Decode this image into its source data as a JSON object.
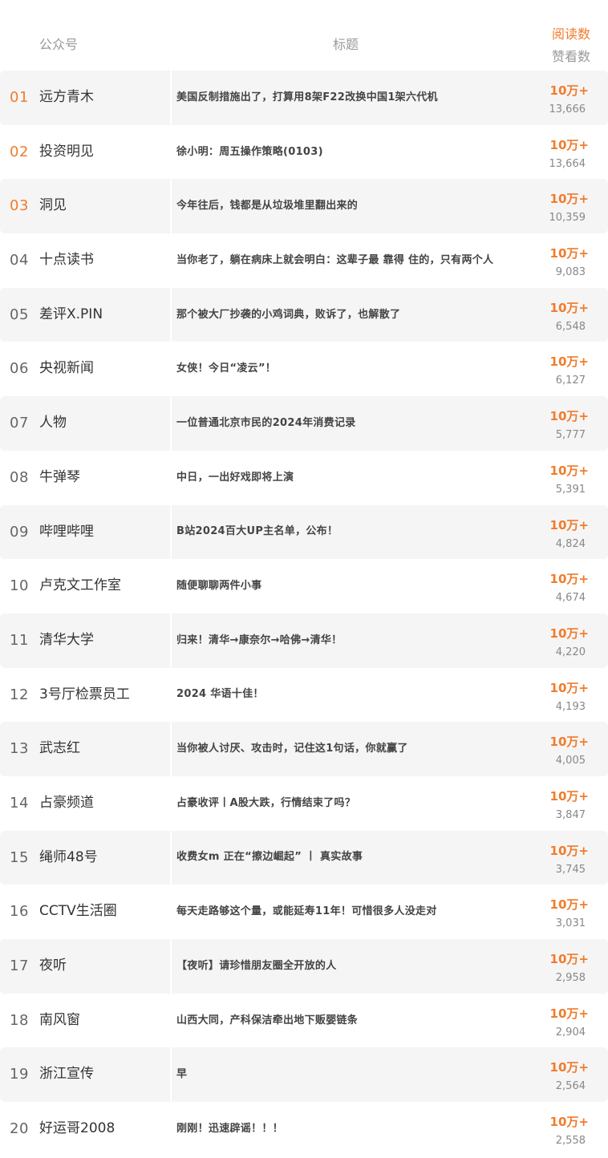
{
  "header": {
    "account_label": "公众号",
    "title_label": "标题",
    "reads_label": "阅读数",
    "likes_label": "赞看数"
  },
  "colors": {
    "accent": "#f07c2c",
    "row_shade": "#f5f5f5",
    "muted": "#9a9a9a"
  },
  "rows": [
    {
      "rank": "01",
      "account": "远方青木",
      "title": "美国反制措施出了，打算用8架F22改换中国1架六代机",
      "reads": "10万+",
      "likes": "13,666"
    },
    {
      "rank": "02",
      "account": "投资明见",
      "title": "徐小明：周五操作策略(0103)",
      "reads": "10万+",
      "likes": "13,664"
    },
    {
      "rank": "03",
      "account": "洞见",
      "title": "今年往后，钱都是从垃圾堆里翻出来的",
      "reads": "10万+",
      "likes": "10,359"
    },
    {
      "rank": "04",
      "account": "十点读书",
      "title": "当你老了，躺在病床上就会明白：这辈子最 靠得 住的，只有两个人",
      "reads": "10万+",
      "likes": "9,083"
    },
    {
      "rank": "05",
      "account": "差评X.PIN",
      "title": "那个被大厂抄袭的小鸡词典，败诉了，也解散了",
      "reads": "10万+",
      "likes": "6,548"
    },
    {
      "rank": "06",
      "account": "央视新闻",
      "title": "女侠！今日“凌云”！",
      "reads": "10万+",
      "likes": "6,127"
    },
    {
      "rank": "07",
      "account": "人物",
      "title": "一位普通北京市民的2024年消费记录",
      "reads": "10万+",
      "likes": "5,777"
    },
    {
      "rank": "08",
      "account": "牛弹琴",
      "title": "中日，一出好戏即将上演",
      "reads": "10万+",
      "likes": "5,391"
    },
    {
      "rank": "09",
      "account": "哔哩哔哩",
      "title": "B站2024百大UP主名单，公布！",
      "reads": "10万+",
      "likes": "4,824"
    },
    {
      "rank": "10",
      "account": "卢克文工作室",
      "title": "随便聊聊两件小事",
      "reads": "10万+",
      "likes": "4,674"
    },
    {
      "rank": "11",
      "account": "清华大学",
      "title": "归来！清华→康奈尔→哈佛→清华！",
      "reads": "10万+",
      "likes": "4,220"
    },
    {
      "rank": "12",
      "account": "3号厅检票员工",
      "title": "2024 华语十佳！",
      "reads": "10万+",
      "likes": "4,193"
    },
    {
      "rank": "13",
      "account": "武志红",
      "title": "当你被人讨厌、攻击时，记住这1句话，你就赢了",
      "reads": "10万+",
      "likes": "4,005"
    },
    {
      "rank": "14",
      "account": "占豪频道",
      "title": "占豪收评丨A股大跌，行情结束了吗？",
      "reads": "10万+",
      "likes": "3,847"
    },
    {
      "rank": "15",
      "account": "绳师48号",
      "title": "收费女m 正在“擦边崛起” 丨 真实故事",
      "reads": "10万+",
      "likes": "3,745"
    },
    {
      "rank": "16",
      "account": "CCTV生活圈",
      "title": "每天走路够这个量，或能延寿11年！可惜很多人没走对",
      "reads": "10万+",
      "likes": "3,031"
    },
    {
      "rank": "17",
      "account": "夜听",
      "title": "【夜听】请珍惜朋友圈全开放的人",
      "reads": "10万+",
      "likes": "2,958"
    },
    {
      "rank": "18",
      "account": "南风窗",
      "title": "山西大同，产科保洁牵出地下贩婴链条",
      "reads": "10万+",
      "likes": "2,904"
    },
    {
      "rank": "19",
      "account": "浙江宣传",
      "title": "早",
      "reads": "10万+",
      "likes": "2,564"
    },
    {
      "rank": "20",
      "account": "好运哥2008",
      "title": "刚刚！迅速辟谣！！！",
      "reads": "10万+",
      "likes": "2,558"
    }
  ]
}
